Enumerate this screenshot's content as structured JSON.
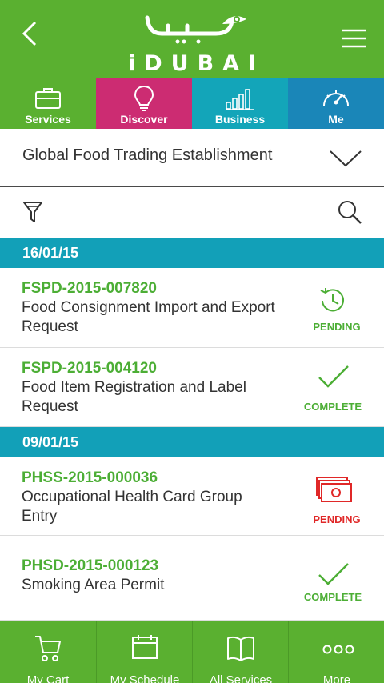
{
  "app": {
    "logo_text": "iDUBAI",
    "brand_color": "#5ab030"
  },
  "header": {
    "back_icon": "chevron-left-icon",
    "menu_icon": "hamburger-menu-icon"
  },
  "categories": [
    {
      "label": "Services",
      "icon": "briefcase-icon",
      "color": "#5ab030"
    },
    {
      "label": "Discover",
      "icon": "lightbulb-icon",
      "color": "#cc2c72"
    },
    {
      "label": "Business",
      "icon": "bar-chart-icon",
      "color": "#13a5b9"
    },
    {
      "label": "Me",
      "icon": "speedometer-icon",
      "color": "#1a86b8"
    }
  ],
  "entity": {
    "name": "Global Food Trading Establishment",
    "dropdown_icon": "chevron-down-icon"
  },
  "toolbar": {
    "filter_icon": "filter-icon",
    "search_icon": "search-icon"
  },
  "groups": [
    {
      "date": "16/01/15",
      "requests": [
        {
          "id": "FSPD-2015-007820",
          "title": "Food Consignment Import and Export Request",
          "status": "PENDING",
          "status_icon": "clock-icon",
          "status_color": "#4cae35"
        },
        {
          "id": "FSPD-2015-004120",
          "title": "Food Item Registration and Label Request",
          "status": "COMPLETE",
          "status_icon": "checkmark-icon",
          "status_color": "#4cae35"
        }
      ]
    },
    {
      "date": "09/01/15",
      "requests": [
        {
          "id": "PHSS-2015-000036",
          "title": "Occupational Health Card Group Entry",
          "status": "PENDING",
          "status_icon": "payment-cash-icon",
          "status_color": "#e02828"
        },
        {
          "id": "PHSD-2015-000123",
          "title": "Smoking Area Permit",
          "status": "COMPLETE",
          "status_icon": "checkmark-icon",
          "status_color": "#4cae35"
        }
      ]
    }
  ],
  "bottom_nav": [
    {
      "label": "My Cart",
      "icon": "cart-icon"
    },
    {
      "label": "My Schedule",
      "icon": "calendar-icon"
    },
    {
      "label": "All Services",
      "icon": "book-icon"
    },
    {
      "label": "More",
      "icon": "more-dots-icon"
    }
  ]
}
